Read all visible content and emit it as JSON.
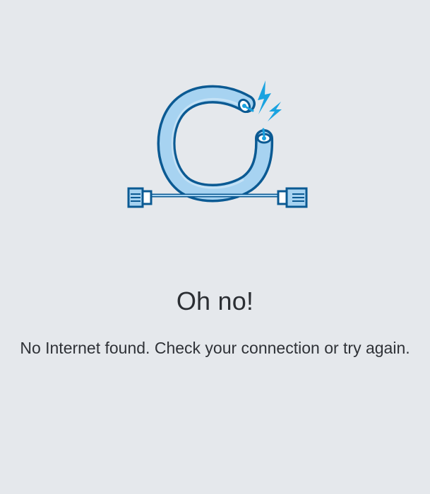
{
  "error": {
    "title": "Oh no!",
    "message": "No Internet found. Check your connection or try again.",
    "illustration_icon": "disconnected-cable-icon"
  },
  "colors": {
    "background": "#e5e8ec",
    "icon_dark": "#0b5a93",
    "icon_light": "#a7d3f1",
    "spark": "#1ba3e0",
    "text": "#2b2e33"
  }
}
